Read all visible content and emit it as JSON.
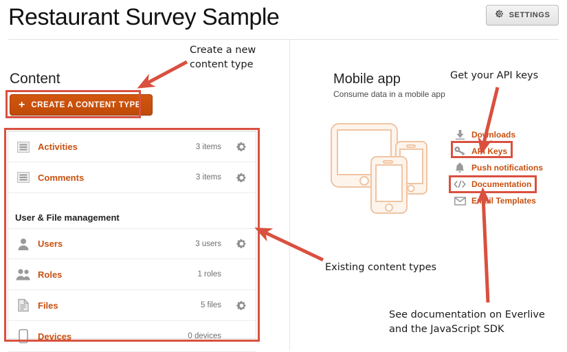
{
  "header": {
    "title": "Restaurant Survey Sample",
    "settings_label": "SETTINGS",
    "settings_icon": "gear-icon"
  },
  "left": {
    "content_heading": "Content",
    "create_button": {
      "label": "CREATE A CONTENT TYPE",
      "icon": "plus-icon"
    },
    "content_types": [
      {
        "icon": "list-icon",
        "label": "Activities",
        "count": "3 items",
        "gear": true
      },
      {
        "icon": "list-icon",
        "label": "Comments",
        "count": "3 items",
        "gear": true
      }
    ],
    "section_title": "User & File management",
    "management_items": [
      {
        "icon": "user-icon",
        "label": "Users",
        "count": "3 users",
        "gear": true
      },
      {
        "icon": "users-icon",
        "label": "Roles",
        "count": "1 roles",
        "gear": false
      },
      {
        "icon": "file-icon",
        "label": "Files",
        "count": "5 files",
        "gear": true
      },
      {
        "icon": "device-icon",
        "label": "Devices",
        "count": "0 devices",
        "gear": false
      }
    ]
  },
  "right": {
    "heading": "Mobile app",
    "subtitle": "Consume data in a mobile app",
    "illustration": "tablet-and-phones-illustration",
    "links": [
      {
        "icon": "download-icon",
        "label": "Downloads"
      },
      {
        "icon": "key-icon",
        "label": "API Keys"
      },
      {
        "icon": "bell-icon",
        "label": "Push notifications"
      },
      {
        "icon": "code-icon",
        "label": "Documentation"
      },
      {
        "icon": "envelope-icon",
        "label": "Email Templates"
      }
    ]
  },
  "annotations": {
    "create_new": "Create a new\ncontent type",
    "api_keys": "Get your API keys",
    "existing_types": "Existing content types",
    "documentation": "See documentation on Everlive\nand the JavaScript SDK"
  },
  "colors": {
    "brand_orange": "#c8500f",
    "button_orange": "#c8500f",
    "annotation_red": "#d9503f",
    "illustration_peach": "#f2c9a8"
  }
}
